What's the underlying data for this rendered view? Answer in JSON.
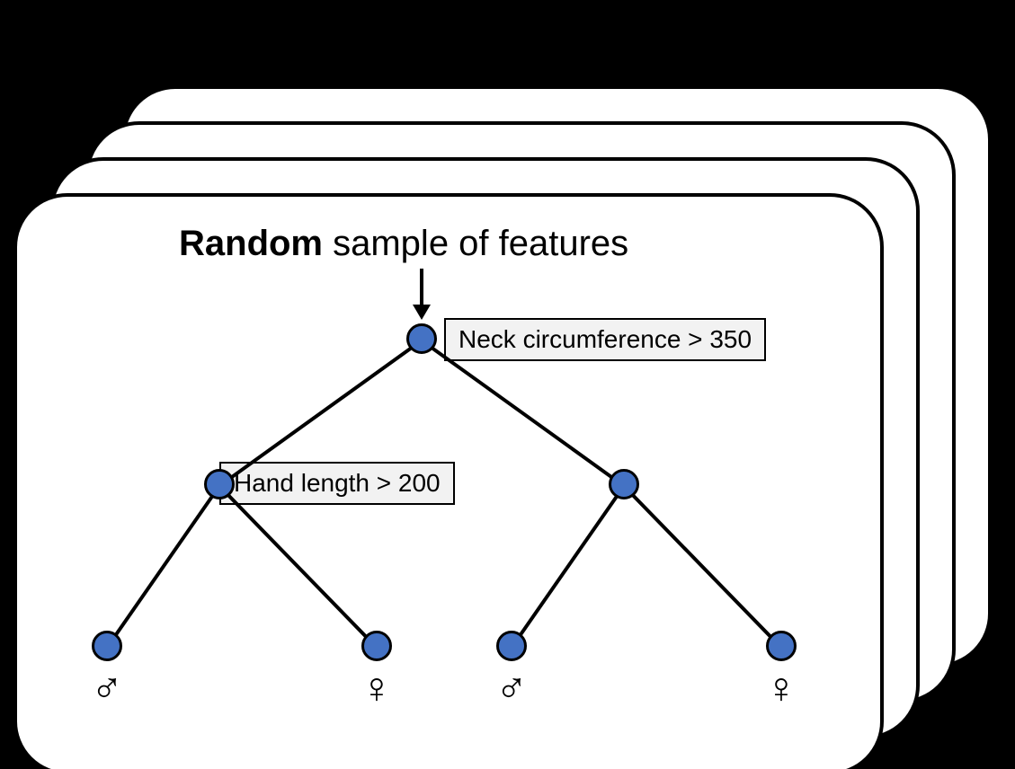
{
  "title_bold": "Random",
  "title_rest": " sample of features",
  "root_label": "Neck circumference > 350",
  "left_label": "Hand length > 200",
  "leaves": {
    "ll": "♂",
    "lr": "♀",
    "rl": "♂",
    "rr": "♀"
  },
  "colors": {
    "node_fill": "#4472C4",
    "label_bg": "#f2f2f2"
  }
}
